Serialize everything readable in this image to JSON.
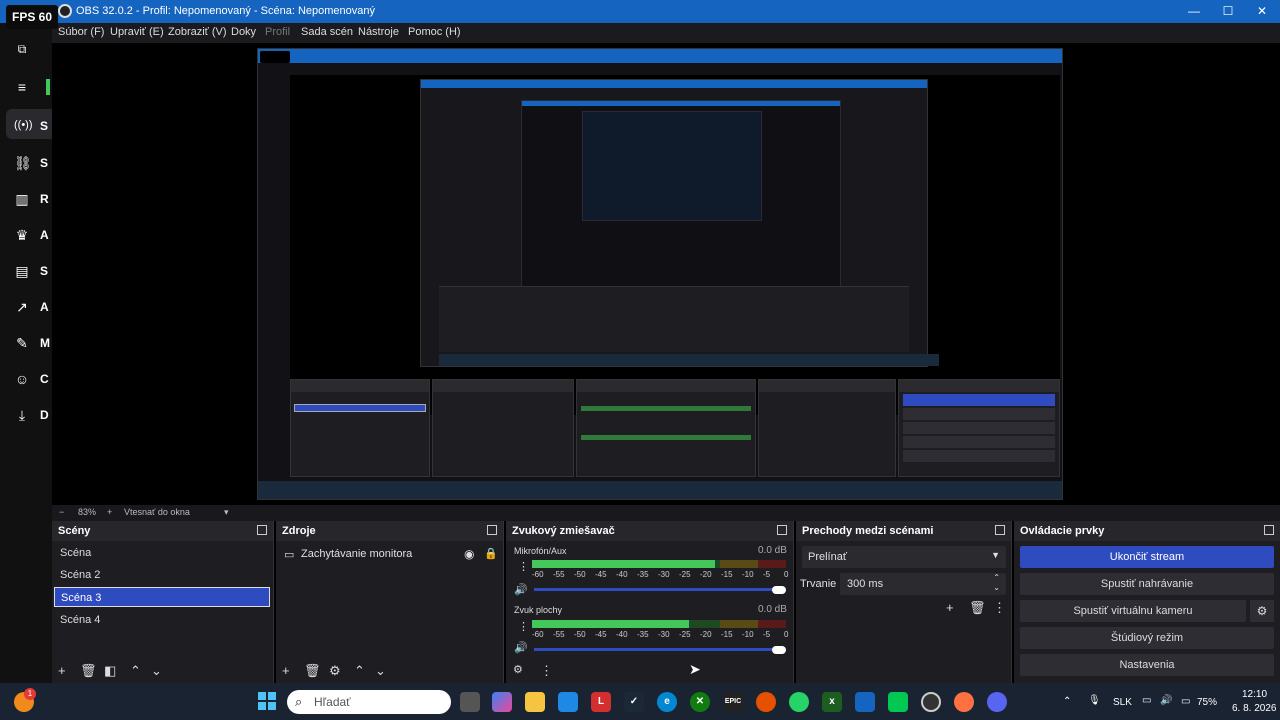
{
  "window": {
    "fps": "FPS 60",
    "title": "OBS 32.0.2 - Profil: Nepomenovaný - Scéna: Nepomenovaný",
    "minimize": "—",
    "maximize": "☐",
    "close": "✕"
  },
  "menu": [
    "Súbor (F)",
    "Upraviť (E)",
    "Zobraziť (V)",
    "Doky",
    "Profil",
    "Sada scén",
    "Nástroje",
    "Pomoc (H)"
  ],
  "sidebar": {
    "items": [
      {
        "icon": "hamburger-icon",
        "label": ""
      },
      {
        "icon": "stream-icon",
        "label": "S"
      },
      {
        "icon": "link-icon",
        "label": "S"
      },
      {
        "icon": "chart-icon",
        "label": "R"
      },
      {
        "icon": "trophy-icon",
        "label": "A"
      },
      {
        "icon": "layout-icon",
        "label": "S"
      },
      {
        "icon": "analytics-icon",
        "label": "A"
      },
      {
        "icon": "wrench-icon",
        "label": "M"
      },
      {
        "icon": "people-icon",
        "label": "C"
      },
      {
        "icon": "download-icon",
        "label": "D"
      }
    ]
  },
  "status": {
    "zoom_minus": "−",
    "zoom": "83%",
    "zoom_plus": "+",
    "fit": "Vtesnať do okna"
  },
  "scenes": {
    "title": "Scény",
    "items": [
      "Scéna",
      "Scéna 2",
      "Scéna 3",
      "Scéna 4"
    ],
    "selected_index": 2
  },
  "sources": {
    "title": "Zdroje",
    "items": [
      "Zachytávanie monitora"
    ]
  },
  "mixer": {
    "title": "Zvukový zmiešavač",
    "channels": [
      {
        "name": "Mikrofón/Aux",
        "db": "0.0 dB",
        "level": 0.72
      },
      {
        "name": "Zvuk plochy",
        "db": "0.0 dB",
        "level": 0.62
      }
    ],
    "scale": [
      "-60",
      "-55",
      "-50",
      "-45",
      "-40",
      "-35",
      "-30",
      "-25",
      "-20",
      "-15",
      "-10",
      "-5",
      "0"
    ]
  },
  "transitions": {
    "title": "Prechody medzi scénami",
    "selected": "Prelínať",
    "duration_label": "Trvanie",
    "duration": "300 ms"
  },
  "controls": {
    "title": "Ovládacie prvky",
    "buttons": [
      "Ukončiť stream",
      "Spustiť nahrávanie",
      "Spustiť virtuálnu kameru",
      "Štúdiový režim",
      "Nastavenia"
    ]
  },
  "taskbar": {
    "search_placeholder": "Hľadať",
    "lang": "SLK",
    "battery": "75%",
    "time": "12:10",
    "date": "6. 8. 2026",
    "badge": "1"
  },
  "colors": {
    "titlebar": "#1565c0",
    "selected": "#2e4bbf",
    "meter_green": "#44c85a"
  }
}
